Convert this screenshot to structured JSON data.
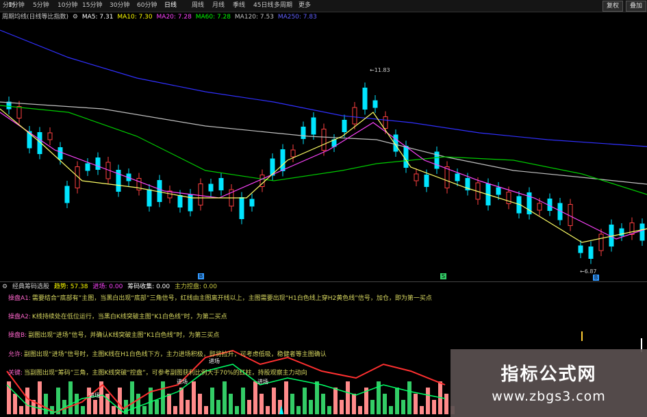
{
  "toolbar": {
    "timeframes": [
      "分时",
      "1分钟",
      "5分钟",
      "10分钟",
      "15分钟",
      "30分钟",
      "60分钟",
      "日线",
      "周线",
      "月线",
      "季线",
      "45日线",
      "多周期",
      "更多"
    ],
    "active": "日线",
    "right_tabs": [
      "复权",
      "叠加"
    ]
  },
  "ma_row": {
    "title": "周期均线(日线等比指数)",
    "ma5": "MA5: 7.31",
    "ma10": "MA10: 7.30",
    "ma20": "MA20: 7.28",
    "ma60": "MA60: 7.28",
    "ma120": "MA120: 7.53",
    "ma250": "MA250: 7.83",
    "colors": {
      "ma5": "#ffffff",
      "ma10": "#ffff00",
      "ma20": "#ff44ff",
      "ma60": "#00ff00",
      "ma120": "#c0c0c0",
      "ma250": "#4040ff"
    }
  },
  "price_labels": {
    "high": "11.83",
    "low": "6.87"
  },
  "indicator": {
    "title": "经典筹码选股",
    "v1": "趋势: 57.38",
    "v2": "进场: 0.00",
    "v3": "筹码收集: 0.00",
    "v4": "主力控盘: 0.00",
    "rules": [
      {
        "label": "操盘A1:",
        "text": "需要结合“底部有”主图，当黑白出现“底部”三角信号，红线由主图离开线以上，主图需要出现“H1白色线上穿H2黄色线”信号，加仓，即为第一买点"
      },
      {
        "label": "操盘A2:",
        "text": "K线持续处在低位运行，当黑白K线突破主图“K1白色线”时，为第二买点"
      },
      {
        "label": "操盘B:",
        "text": "副图出现“进场”信号，并确认K线突破主图“K1白色线”时，为第三买点"
      },
      {
        "label": "允许:",
        "text": "副图出现“进场”信号时，主图K线在H1白色线下方，主力进场积极，即将拉升，可考虑低吸，稳健者等主图确认"
      },
      {
        "label": "关键:",
        "text": "当副图出现“筹码”三角，主图K线突破“控盘”，可参考副图获利比例大于70%的红柱，持股观察主力动向"
      }
    ],
    "signals": [
      "进场",
      "进场",
      "进场",
      "进场"
    ]
  },
  "watermark": {
    "line1": "指标公式网",
    "line2": "www.zbgs3.com"
  }
}
